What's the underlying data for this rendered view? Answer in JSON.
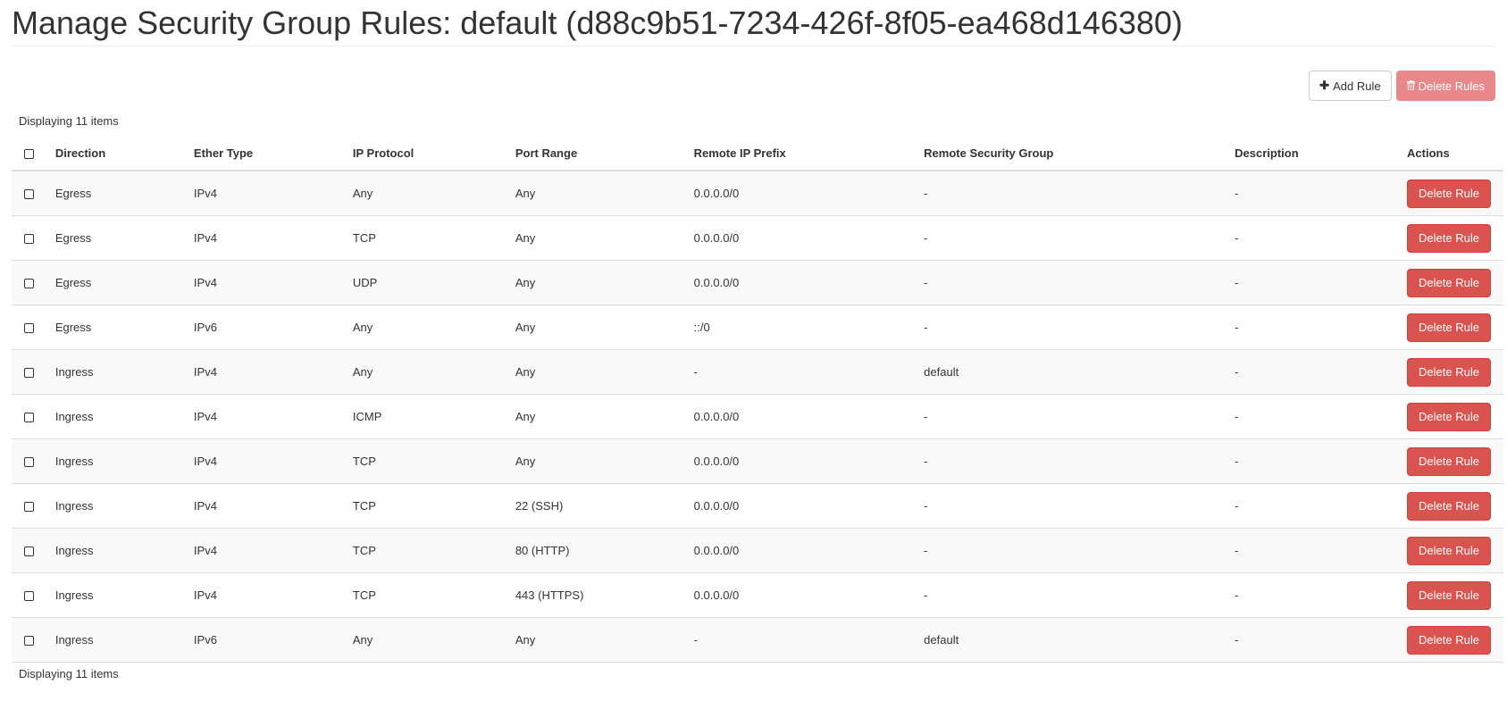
{
  "page": {
    "title": "Manage Security Group Rules: default (d88c9b51-7234-426f-8f05-ea468d146380)"
  },
  "toolbar": {
    "add_rule_label": "Add Rule",
    "delete_rules_label": "Delete Rules"
  },
  "table": {
    "count_text": "Displaying 11 items",
    "columns": {
      "direction": "Direction",
      "ether_type": "Ether Type",
      "ip_protocol": "IP Protocol",
      "port_range": "Port Range",
      "remote_ip_prefix": "Remote IP Prefix",
      "remote_security_group": "Remote Security Group",
      "description": "Description",
      "actions": "Actions"
    },
    "row_action_label": "Delete Rule",
    "rows": [
      {
        "direction": "Egress",
        "ether_type": "IPv4",
        "ip_protocol": "Any",
        "port_range": "Any",
        "remote_ip_prefix": "0.0.0.0/0",
        "remote_security_group": "-",
        "description": "-"
      },
      {
        "direction": "Egress",
        "ether_type": "IPv4",
        "ip_protocol": "TCP",
        "port_range": "Any",
        "remote_ip_prefix": "0.0.0.0/0",
        "remote_security_group": "-",
        "description": "-"
      },
      {
        "direction": "Egress",
        "ether_type": "IPv4",
        "ip_protocol": "UDP",
        "port_range": "Any",
        "remote_ip_prefix": "0.0.0.0/0",
        "remote_security_group": "-",
        "description": "-"
      },
      {
        "direction": "Egress",
        "ether_type": "IPv6",
        "ip_protocol": "Any",
        "port_range": "Any",
        "remote_ip_prefix": "::/0",
        "remote_security_group": "-",
        "description": "-"
      },
      {
        "direction": "Ingress",
        "ether_type": "IPv4",
        "ip_protocol": "Any",
        "port_range": "Any",
        "remote_ip_prefix": "-",
        "remote_security_group": "default",
        "description": "-"
      },
      {
        "direction": "Ingress",
        "ether_type": "IPv4",
        "ip_protocol": "ICMP",
        "port_range": "Any",
        "remote_ip_prefix": "0.0.0.0/0",
        "remote_security_group": "-",
        "description": "-"
      },
      {
        "direction": "Ingress",
        "ether_type": "IPv4",
        "ip_protocol": "TCP",
        "port_range": "Any",
        "remote_ip_prefix": "0.0.0.0/0",
        "remote_security_group": "-",
        "description": "-"
      },
      {
        "direction": "Ingress",
        "ether_type": "IPv4",
        "ip_protocol": "TCP",
        "port_range": "22 (SSH)",
        "remote_ip_prefix": "0.0.0.0/0",
        "remote_security_group": "-",
        "description": "-"
      },
      {
        "direction": "Ingress",
        "ether_type": "IPv4",
        "ip_protocol": "TCP",
        "port_range": "80 (HTTP)",
        "remote_ip_prefix": "0.0.0.0/0",
        "remote_security_group": "-",
        "description": "-"
      },
      {
        "direction": "Ingress",
        "ether_type": "IPv4",
        "ip_protocol": "TCP",
        "port_range": "443 (HTTPS)",
        "remote_ip_prefix": "0.0.0.0/0",
        "remote_security_group": "-",
        "description": "-"
      },
      {
        "direction": "Ingress",
        "ether_type": "IPv6",
        "ip_protocol": "Any",
        "port_range": "Any",
        "remote_ip_prefix": "-",
        "remote_security_group": "default",
        "description": "-"
      }
    ]
  }
}
